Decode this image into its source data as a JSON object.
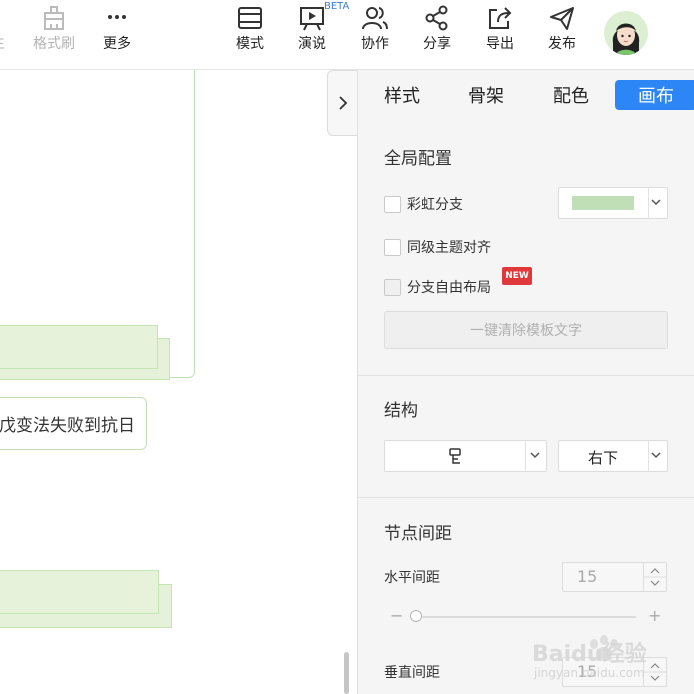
{
  "toolbar": {
    "partial_label": "生",
    "format_brush": "格式刷",
    "more": "更多",
    "mode": "模式",
    "present": "演说",
    "beta": "BETA",
    "collab": "协作",
    "share": "分享",
    "export": "导出",
    "publish": "发布"
  },
  "canvas": {
    "node_text": "戊变法失败到抗日"
  },
  "panel": {
    "tabs": [
      "样式",
      "骨架",
      "配色",
      "画布"
    ],
    "active_tab": "画布",
    "global_title": "全局配置",
    "rainbow_label": "彩虹分支",
    "align_label": "同级主题对齐",
    "free_layout_label": "分支自由布局",
    "new_badge": "NEW",
    "rainbow_color": "#c1dfb6",
    "clear_button": "一键清除模板文字",
    "structure_title": "结构",
    "structure_direction": "右下",
    "spacing_title": "节点间距",
    "horizontal_label": "水平间距",
    "horizontal_value": "15",
    "horizontal_slider_fraction": 0.0,
    "vertical_label": "垂直间距",
    "vertical_value": "15"
  },
  "watermark": {
    "brand": "Baidu经验",
    "url": "jingyan.baidu.com"
  },
  "colors": {
    "accent": "#2d86f5",
    "node_green": "#e6f3da",
    "node_border": "#c3dfb9",
    "badge": "#e0393c"
  }
}
